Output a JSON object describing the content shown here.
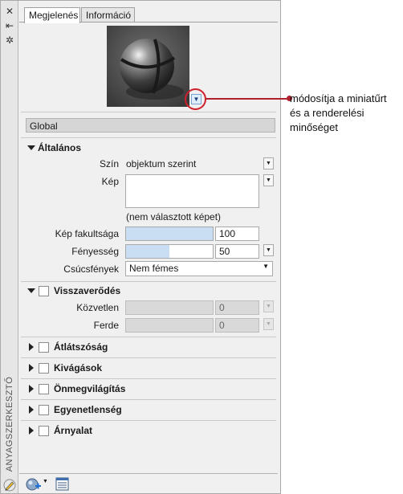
{
  "palette": {
    "title": "ANYAGSZERKESZTŐ",
    "tabs": [
      {
        "label": "Megjelenés"
      },
      {
        "label": "Információ"
      }
    ]
  },
  "callout": {
    "line1": "módosítja a miniatűrt",
    "line2": "és a renderelési",
    "line3": "minőséget"
  },
  "global_label": "Global",
  "general": {
    "title": "Általános",
    "color_label": "Szín",
    "color_value": "objektum szerint",
    "image_label": "Kép",
    "image_caption": "(nem választott képet)",
    "fade_label": "Kép fakultsága",
    "fade_value": "100",
    "fade_fraction": 1.0,
    "gloss_label": "Fényesség",
    "gloss_value": "50",
    "gloss_fraction": 0.5,
    "highlights_label": "Csúcsfények",
    "highlights_value": "Nem fémes"
  },
  "reflectivity": {
    "title": "Visszaverődés",
    "direct_label": "Közvetlen",
    "direct_value": "0",
    "oblique_label": "Ferde",
    "oblique_value": "0"
  },
  "collapsed_sections": [
    "Átlátszóság",
    "Kivágások",
    "Önmegvilágítás",
    "Egyenetlenség",
    "Árnyalat"
  ]
}
